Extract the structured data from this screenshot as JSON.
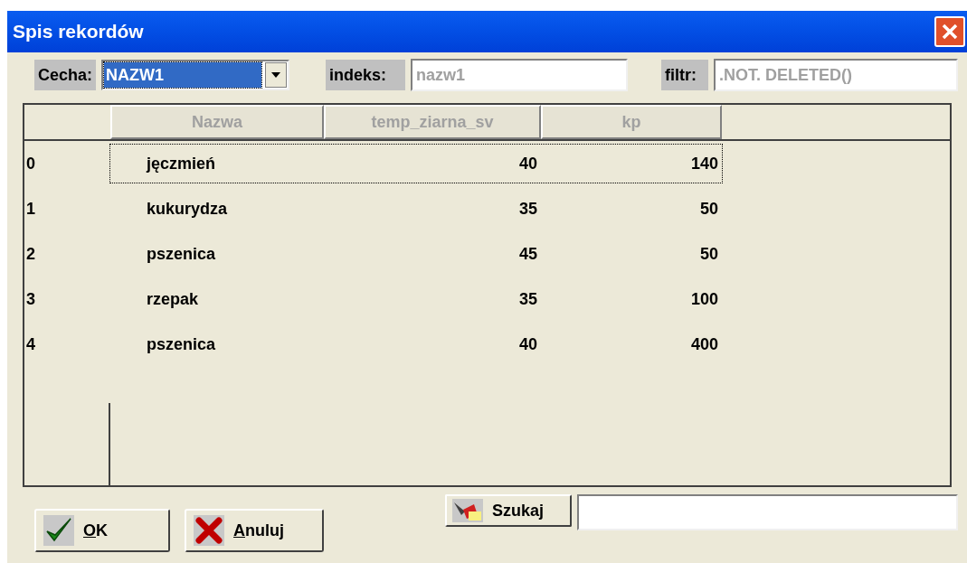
{
  "window": {
    "title": "Spis rekordów"
  },
  "toolbar": {
    "feature_label": "Cecha:",
    "feature_value": "NAZW1",
    "index_label": "indeks:",
    "index_value": "nazw1",
    "filter_label": "filtr:",
    "filter_value": ".NOT. DELETED()"
  },
  "table": {
    "columns": [
      "Nazwa",
      "temp_ziarna_sv",
      "kp"
    ],
    "rows": [
      {
        "number": "0",
        "cells": [
          "jęczmień",
          "40",
          "140"
        ],
        "selected": true
      },
      {
        "number": "1",
        "cells": [
          "kukurydza",
          "35",
          "50"
        ],
        "selected": false
      },
      {
        "number": "2",
        "cells": [
          "pszenica",
          "45",
          "50"
        ],
        "selected": false
      },
      {
        "number": "3",
        "cells": [
          "rzepak",
          "35",
          "100"
        ],
        "selected": false
      },
      {
        "number": "4",
        "cells": [
          "pszenica",
          "40",
          "400"
        ],
        "selected": false
      }
    ]
  },
  "search_button": "Szukaj",
  "buttons": [
    {
      "kind": "ok",
      "label": "OK"
    },
    {
      "kind": "cancel",
      "label": "Anuluj"
    }
  ]
}
